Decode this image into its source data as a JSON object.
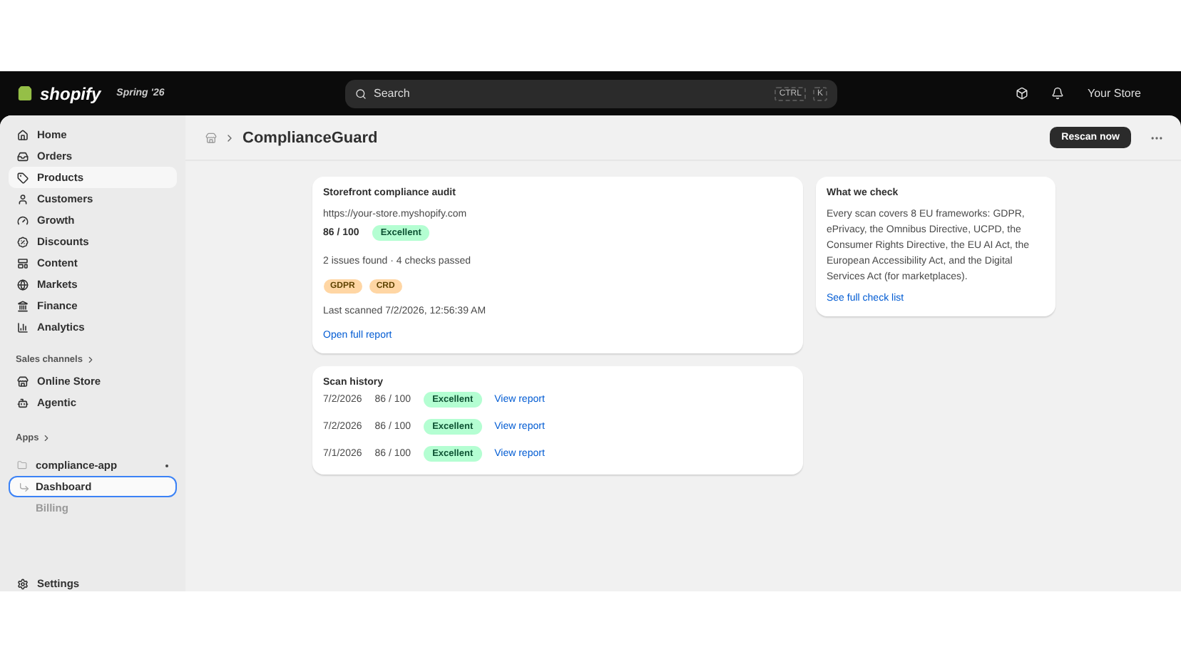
{
  "topbar": {
    "brand": "shopify",
    "edition": "Spring '26",
    "search": {
      "placeholder": "Search",
      "shortcut": [
        "CTRL",
        "K"
      ]
    },
    "store": "Your Store"
  },
  "sidebar": {
    "items": [
      {
        "label": "Home",
        "selected": false
      },
      {
        "label": "Orders",
        "selected": false
      },
      {
        "label": "Products",
        "selected": true
      },
      {
        "label": "Customers",
        "selected": false
      },
      {
        "label": "Growth",
        "selected": false
      },
      {
        "label": "Discounts",
        "selected": false
      },
      {
        "label": "Content",
        "selected": false
      },
      {
        "label": "Markets",
        "selected": false
      },
      {
        "label": "Finance",
        "selected": false
      },
      {
        "label": "Analytics",
        "selected": false
      }
    ],
    "sales_channels": {
      "heading": "Sales channels",
      "items": [
        {
          "label": "Online Store",
          "selected": false
        },
        {
          "label": "Agentic",
          "selected": false
        }
      ]
    },
    "apps": {
      "heading": "Apps",
      "items": [
        {
          "label": "compliance-app",
          "children": [
            {
              "label": "Dashboard",
              "selected": true
            },
            {
              "label": "Billing",
              "selected": false
            }
          ]
        }
      ]
    },
    "footer": "Settings"
  },
  "page": {
    "title": "ComplianceGuard",
    "primary_action": "Rescan now",
    "audit": {
      "title": "Storefront compliance audit",
      "url": "https://your-store.myshopify.com",
      "score": "86 / 100",
      "badge": "Excellent",
      "summary": "2 issues found · 4 checks passed",
      "tags": [
        "GDPR",
        "CRD"
      ],
      "last_scanned": "Last scanned 7/2/2026, 12:56:39 AM",
      "link": "Open full report"
    },
    "history": {
      "title": "Scan history",
      "rows": [
        {
          "date": "7/2/2026",
          "score": "86 / 100",
          "badge": "Excellent",
          "link": "View report"
        },
        {
          "date": "7/2/2026",
          "score": "86 / 100",
          "badge": "Excellent",
          "link": "View report"
        },
        {
          "date": "7/1/2026",
          "score": "86 / 100",
          "badge": "Excellent",
          "link": "View report"
        }
      ]
    },
    "info": {
      "title": "What we check",
      "body": "Every scan covers 8 EU frameworks: GDPR, ePrivacy, the Omnibus Directive, UCPD, the Consumer Rights Directive, the EU AI Act, the European Accessibility Act, and the Digital Services Act (for marketplaces).",
      "link": "See full check list"
    }
  }
}
